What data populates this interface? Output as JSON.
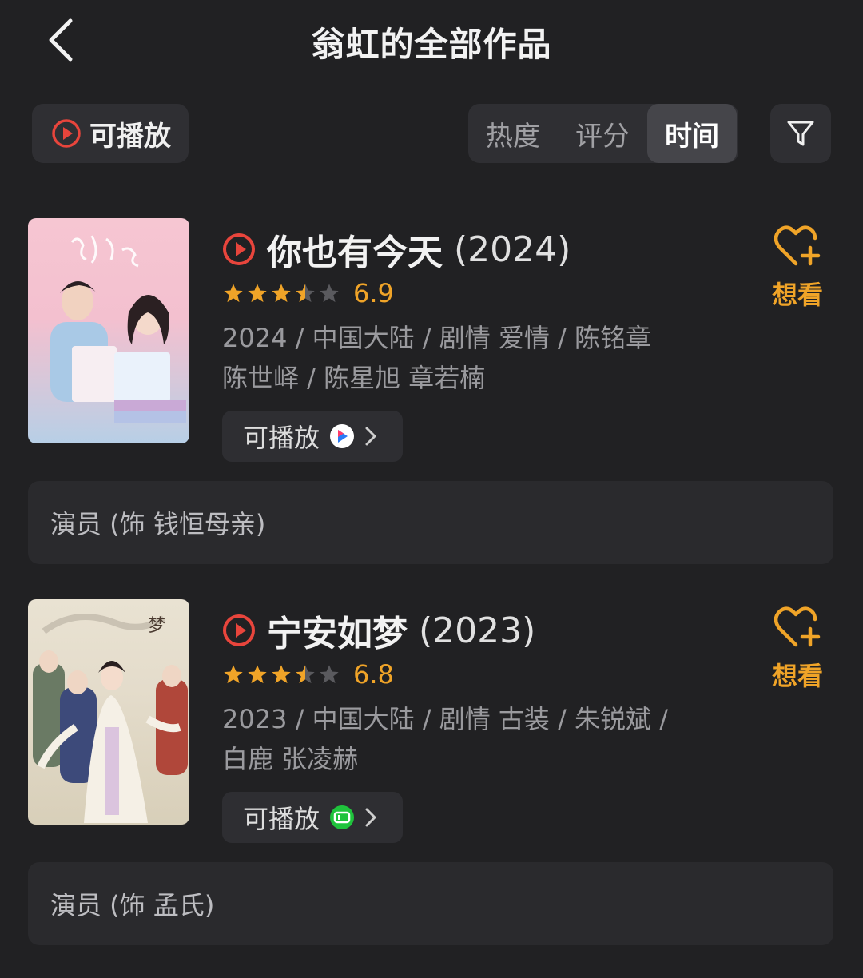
{
  "header": {
    "title": "翁虹的全部作品"
  },
  "toolbar": {
    "playable_label": "可播放",
    "sort_tabs": [
      "热度",
      "评分",
      "时间"
    ],
    "active_sort": "时间"
  },
  "works": [
    {
      "title": "你也有今天",
      "year": "(2024)",
      "rating": 6.9,
      "stars": 3.5,
      "meta_line1": "2024 / 中国大陆 / 剧情 爱情 / 陈铭章",
      "meta_line2": "陈世峄 / 陈星旭 章若楠",
      "play_label": "可播放",
      "platform_icon": "youku-icon",
      "want_label": "想看",
      "role": "演员 (饰 钱恒母亲)"
    },
    {
      "title": "宁安如梦",
      "year": "(2023)",
      "rating": 6.8,
      "stars": 3.5,
      "meta_line1": "2023 / 中国大陆 / 剧情 古装 / 朱锐斌 /",
      "meta_line2": "白鹿 张凌赫",
      "play_label": "可播放",
      "platform_icon": "iqiyi-icon",
      "want_label": "想看",
      "role": "演员 (饰 孟氏)"
    }
  ],
  "colors": {
    "background": "#212123",
    "accent_orange": "#f0a428",
    "play_red": "#e8453c"
  }
}
